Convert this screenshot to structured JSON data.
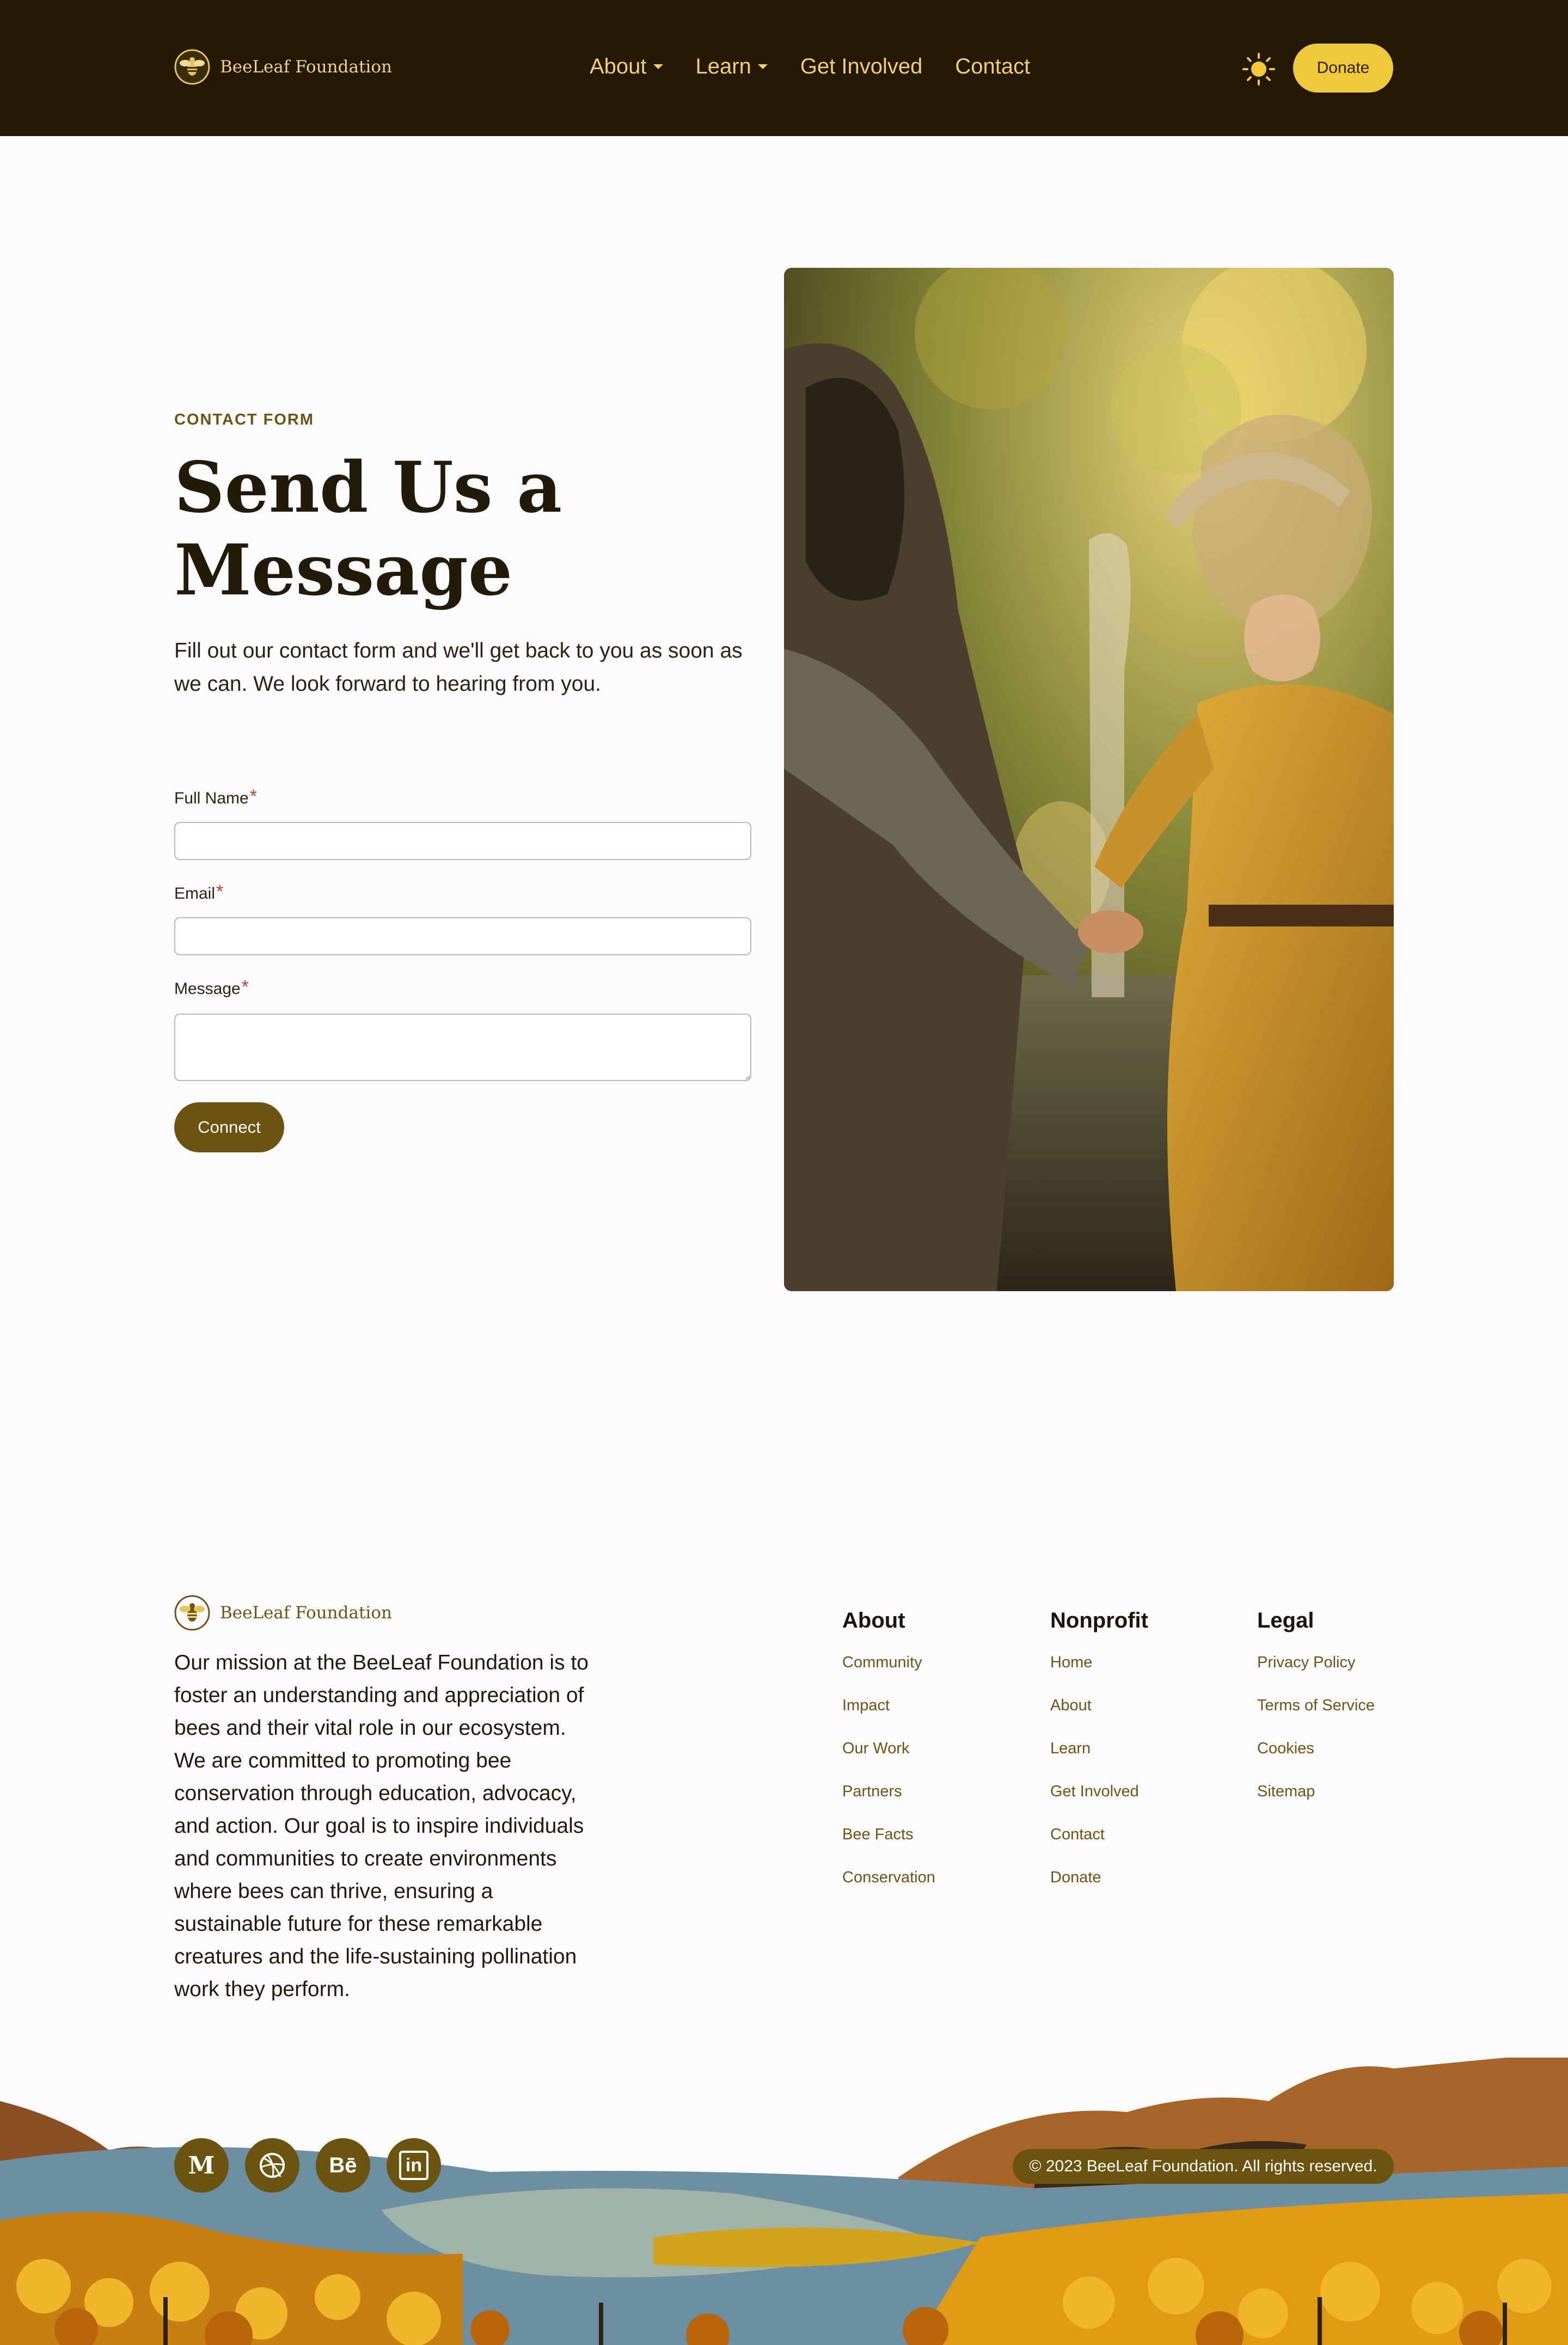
{
  "nav": {
    "brand": "BeeLeaf Foundation",
    "items": [
      {
        "label": "About",
        "dropdown": true
      },
      {
        "label": "Learn",
        "dropdown": true
      },
      {
        "label": "Get Involved",
        "dropdown": false
      },
      {
        "label": "Contact",
        "dropdown": false
      }
    ],
    "theme_icon": "sun-icon",
    "donate_label": "Donate"
  },
  "form_section": {
    "eyebrow": "CONTACT FORM",
    "title": "Send Us a Message",
    "lead": "Fill out our contact form and we'll get back to you as soon as we can. We look forward to hearing from you.",
    "fields": [
      {
        "label": "Full Name",
        "required": true,
        "value": ""
      },
      {
        "label": "Email",
        "required": true,
        "value": ""
      },
      {
        "label": "Message",
        "required": true,
        "value": ""
      }
    ],
    "submit_label": "Connect",
    "photo": "beekeepers-handshake-photo"
  },
  "footer": {
    "brand": "BeeLeaf Foundation",
    "mission": "Our mission at the BeeLeaf Foundation is to foster an understanding and appreciation of bees and their vital role in our ecosystem. We are committed to promoting bee conservation through education, advocacy, and action. Our goal is to inspire individuals and communities to create environments where bees can thrive, ensuring a sustainable future for these remarkable creatures and the life-sustaining pollination work they perform.",
    "columns": [
      {
        "title": "About",
        "links": [
          "Community",
          "Impact",
          "Our Work",
          "Partners",
          "Bee Facts",
          "Conservation"
        ]
      },
      {
        "title": "Nonprofit",
        "links": [
          "Home",
          "About",
          "Learn",
          "Get Involved",
          "Contact",
          "Donate"
        ]
      },
      {
        "title": "Legal",
        "links": [
          "Privacy Policy",
          "Terms of Service",
          "Cookies",
          "Sitemap"
        ]
      }
    ],
    "social": [
      {
        "name": "medium-icon",
        "glyph": "M"
      },
      {
        "name": "dribbble-icon",
        "glyph": ""
      },
      {
        "name": "behance-icon",
        "glyph": "Bē"
      },
      {
        "name": "linkedin-icon",
        "glyph": "in"
      }
    ],
    "copyright": "© 2023 BeeLeaf Foundation. All rights reserved."
  },
  "colors": {
    "nav_bg": "#221803",
    "accent": "#f0c93a",
    "brand_brown": "#6b540f",
    "page_bg": "#fcfafc"
  }
}
